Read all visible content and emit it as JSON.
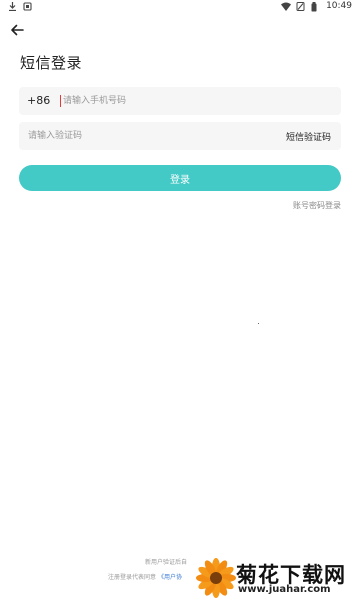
{
  "status_bar": {
    "time": "10:49",
    "left_icons": [
      "download-icon",
      "notification-icon"
    ],
    "right_icons": [
      "wifi-icon",
      "sim-icon",
      "battery-icon"
    ]
  },
  "header": {
    "back_icon": "back-arrow-icon",
    "title": "短信登录"
  },
  "form": {
    "country_code": "+86",
    "phone_placeholder": "请输入手机号码",
    "code_placeholder": "请输入验证码",
    "send_code_label": "短信验证码",
    "login_label": "登录",
    "password_login_label": "账号密码登录"
  },
  "footer": {
    "line1": "新用户验证后自",
    "line2_prefix": "注册登录代表同意",
    "line2_link": "《用户协"
  },
  "watermark": {
    "text": "菊花下载网",
    "url": "www.juahar.com"
  },
  "colors": {
    "accent": "#43c9c6",
    "caret": "#e53935",
    "field_bg": "#f6f6f6"
  }
}
